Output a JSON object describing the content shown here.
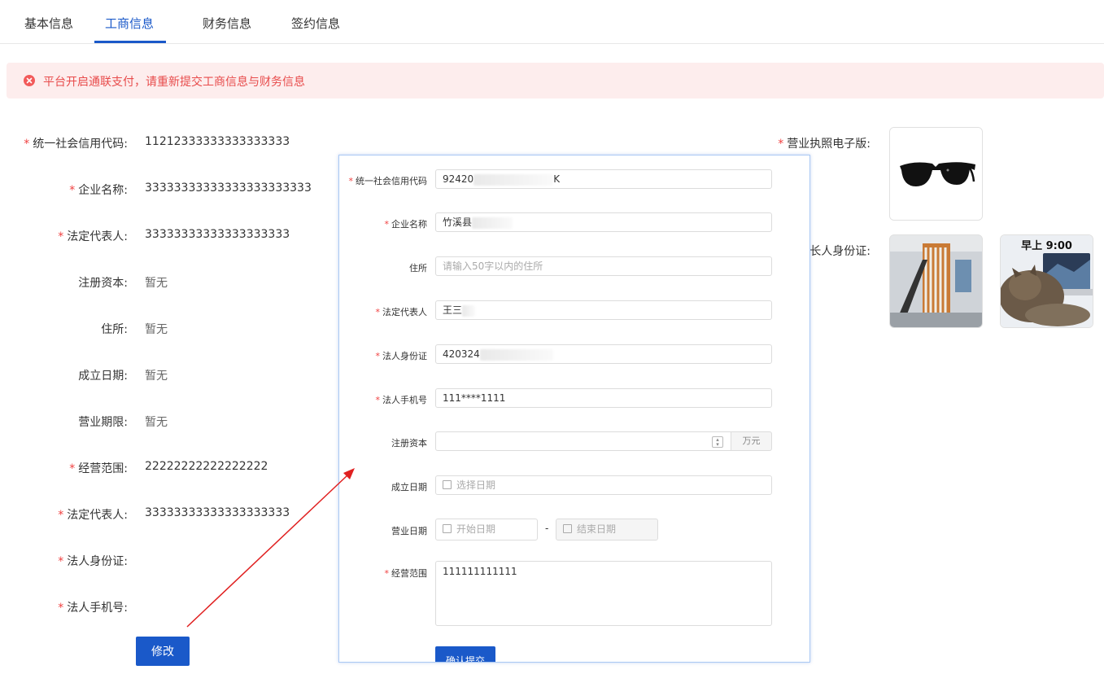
{
  "tabs": [
    {
      "label": "基本信息"
    },
    {
      "label": "工商信息"
    },
    {
      "label": "财务信息"
    },
    {
      "label": "签约信息"
    }
  ],
  "alert": {
    "text": "平台开启通联支付，请重新提交工商信息与财务信息"
  },
  "info": {
    "credit_code": {
      "label": "统一社会信用代码:",
      "value": "11212333333333333333"
    },
    "company_name": {
      "label": "企业名称:",
      "value": "33333333333333333333333"
    },
    "legal_rep": {
      "label": "法定代表人:",
      "value": "33333333333333333333"
    },
    "reg_capital": {
      "label": "注册资本:",
      "value": "暂无"
    },
    "address": {
      "label": "住所:",
      "value": "暂无"
    },
    "founded": {
      "label": "成立日期:",
      "value": "暂无"
    },
    "term": {
      "label": "营业期限:",
      "value": "暂无"
    },
    "scope": {
      "label": "经营范围:",
      "value": "22222222222222222"
    },
    "legal_rep2": {
      "label": "法定代表人:",
      "value": "33333333333333333333"
    },
    "legal_id": {
      "label": "法人身份证:"
    },
    "legal_phone": {
      "label": "法人手机号:"
    },
    "license": {
      "label": "营业执照电子版:"
    },
    "id_card": {
      "label": "法人身份证:",
      "label_partial": "长人身份证:"
    },
    "cat_caption": "早上 9:00",
    "modify_label": "修改"
  },
  "form": {
    "credit_code": {
      "label": "统一社会信用代码",
      "value_prefix": "92420",
      "value_suffix": "K"
    },
    "company_name": {
      "label": "企业名称",
      "value_prefix": "竹溪县"
    },
    "address": {
      "label": "住所",
      "placeholder": "请输入50字以内的住所"
    },
    "legal_rep": {
      "label": "法定代表人",
      "value_prefix": "王三"
    },
    "legal_id": {
      "label": "法人身份证",
      "value_prefix": "420324"
    },
    "legal_phone": {
      "label": "法人手机号",
      "value": "111****1111"
    },
    "reg_capital": {
      "label": "注册资本",
      "unit": "万元"
    },
    "founded": {
      "label": "成立日期",
      "placeholder": "选择日期"
    },
    "business_date": {
      "label": "营业日期",
      "start_placeholder": "开始日期",
      "separator": "-",
      "end_placeholder": "结束日期"
    },
    "scope": {
      "label": "经营范围",
      "value": "111111111111"
    },
    "submit_label": "确认提交"
  },
  "colors": {
    "primary": "#1a59c9",
    "danger": "#f04040",
    "alert_bg": "#fdeded"
  }
}
